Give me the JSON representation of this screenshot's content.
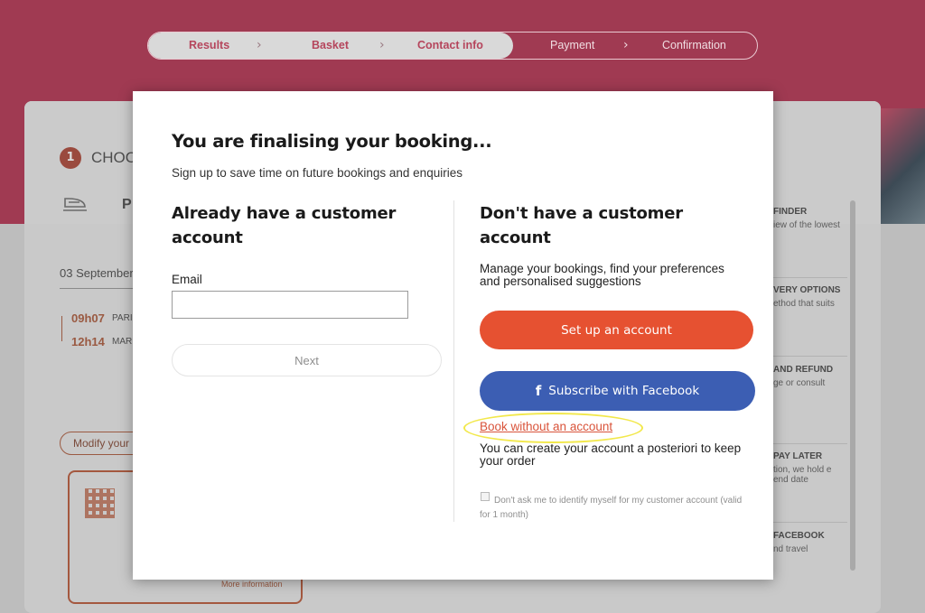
{
  "progress": {
    "steps": [
      {
        "label": "Results",
        "state": "done"
      },
      {
        "label": "Basket",
        "state": "done"
      },
      {
        "label": "Contact info",
        "state": "current"
      },
      {
        "label": "Payment",
        "state": "todo"
      },
      {
        "label": "Confirmation",
        "state": "todo"
      }
    ],
    "chevron": "›"
  },
  "background": {
    "step_number": "1",
    "step_title": "CHOO",
    "passenger_initial": "P",
    "date": "03 September",
    "times": [
      {
        "time": "09h07",
        "place": "PARI"
      },
      {
        "time": "12h14",
        "place": "MAR"
      }
    ],
    "modify_label": "Modify your",
    "more_information": "More information",
    "side_items": [
      {
        "title": "FINDER",
        "desc": "iew of the lowest"
      },
      {
        "title": "VERY OPTIONS",
        "desc": "ethod that suits"
      },
      {
        "title": "AND REFUND",
        "desc": "ge or consult"
      },
      {
        "title": "PAY LATER",
        "desc": "tion, we hold e end date"
      },
      {
        "title": "FACEBOOK",
        "desc": "nd travel"
      }
    ]
  },
  "modal": {
    "title": "You are finalising your booking...",
    "subtitle": "Sign up to save time on future bookings and enquiries",
    "left": {
      "heading": "Already have a customer account",
      "email_label": "Email",
      "email_value": "",
      "email_placeholder": "",
      "next_label": "Next"
    },
    "right": {
      "heading": "Don't have a customer account",
      "description": "Manage your bookings, find your preferences and personalised suggestions",
      "setup_label": "Set up an account",
      "facebook_icon_glyph": "f",
      "facebook_label": "Subscribe with Facebook",
      "book_without_label": "Book without an account",
      "book_without_desc": "You can create your account a posteriori to keep your order",
      "checkbox_label": "Don't ask me to identify myself for my customer account (valid for 1 month)",
      "checkbox_checked": false
    }
  },
  "colors": {
    "brand_header": "#a03a52",
    "primary_orange": "#e65131",
    "facebook_blue": "#3c5eb3",
    "link_red": "#d9533a",
    "highlight_yellow": "#f2e84b"
  }
}
